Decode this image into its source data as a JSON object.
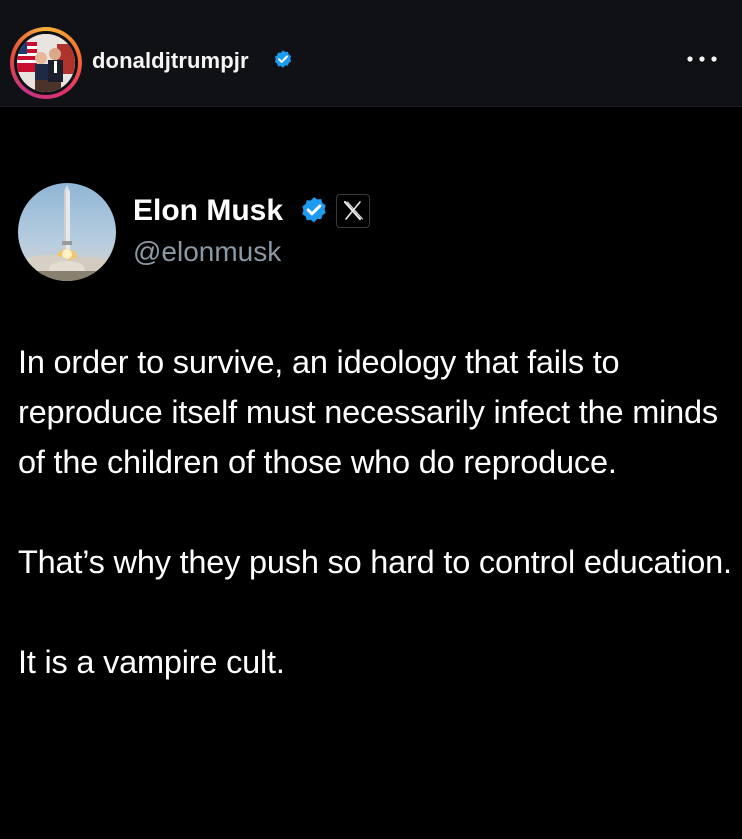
{
  "header": {
    "username": "donaldjtrumpjr",
    "verified_icon": "verified-badge-icon",
    "more_icon": "more-horizontal-icon"
  },
  "tweet": {
    "author_name": "Elon Musk",
    "handle": "@elonmusk",
    "verified_icon": "verified-badge-icon",
    "platform_icon": "x-logo-icon",
    "paragraphs": [
      "In order to survive, an ideology that fails to reproduce itself must necessarily infect the minds of the children of those who do reproduce.",
      "That’s why they push so hard to control education.",
      "It is a vampire cult."
    ]
  },
  "colors": {
    "background": "#000000",
    "header_background": "#101114",
    "verified_blue": "#1d9bf0",
    "handle_gray": "#8b98a5"
  }
}
